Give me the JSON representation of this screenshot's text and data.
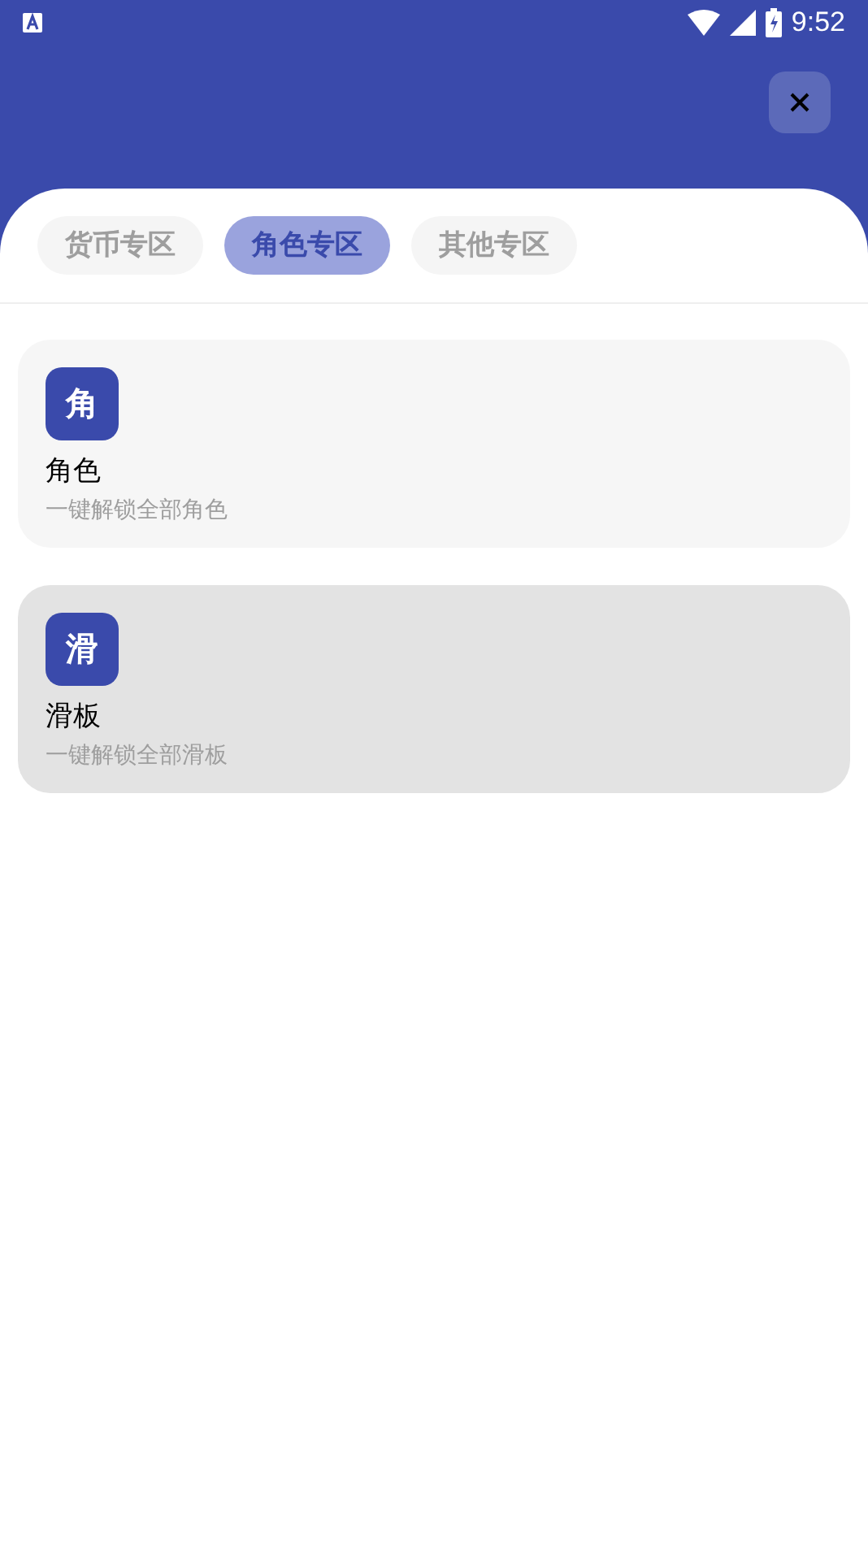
{
  "status_bar": {
    "time": "9:52"
  },
  "tabs": [
    {
      "label": "货币专区",
      "selected": false
    },
    {
      "label": "角色专区",
      "selected": true
    },
    {
      "label": "其他专区",
      "selected": false
    }
  ],
  "items": [
    {
      "icon_text": "角",
      "title": "角色",
      "subtitle": "一键解锁全部角色",
      "pressed": false
    },
    {
      "icon_text": "滑",
      "title": "滑板",
      "subtitle": "一键解锁全部滑板",
      "pressed": true
    }
  ]
}
